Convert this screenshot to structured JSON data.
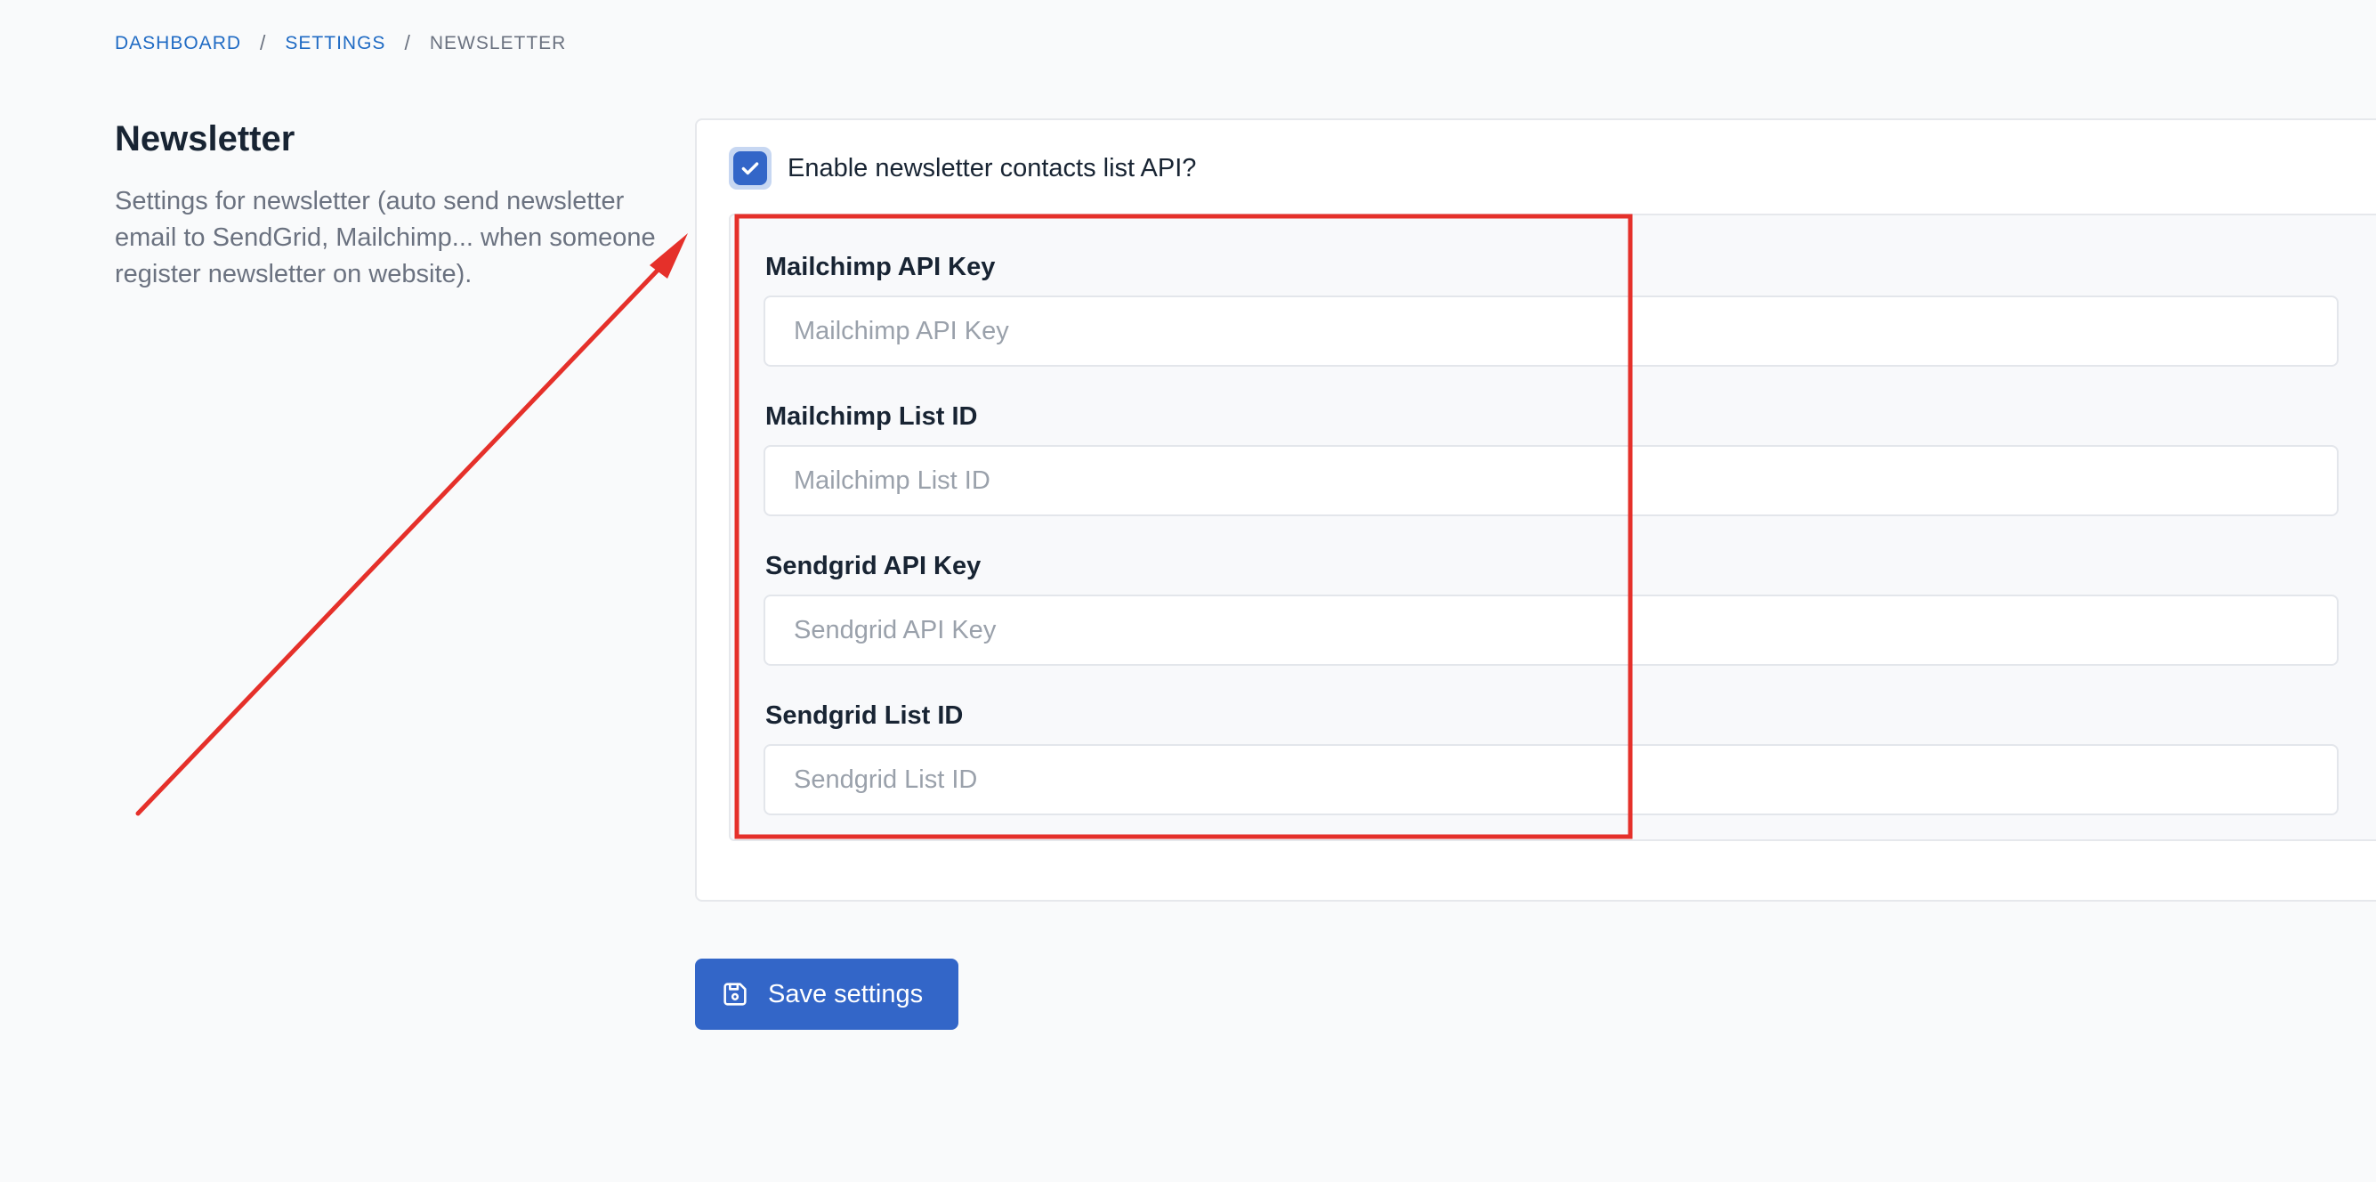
{
  "breadcrumb": {
    "items": [
      "DASHBOARD",
      "SETTINGS"
    ],
    "separator": "/",
    "current": "NEWSLETTER"
  },
  "section": {
    "title": "Newsletter",
    "description": "Settings for newsletter (auto send newsletter email to SendGrid, Mailchimp... when someone register newsletter on website)."
  },
  "enable_api": {
    "label": "Enable newsletter contacts list API?",
    "checked": true
  },
  "fields": [
    {
      "label": "Mailchimp API Key",
      "placeholder": "Mailchimp API Key",
      "value": ""
    },
    {
      "label": "Mailchimp List ID",
      "placeholder": "Mailchimp List ID",
      "value": ""
    },
    {
      "label": "Sendgrid API Key",
      "placeholder": "Sendgrid API Key",
      "value": ""
    },
    {
      "label": "Sendgrid List ID",
      "placeholder": "Sendgrid List ID",
      "value": ""
    }
  ],
  "save_button": {
    "label": "Save settings",
    "icon": "save-icon"
  },
  "colors": {
    "accent": "#3366c8",
    "link": "#206bc4",
    "annotation": "#e5302a"
  }
}
